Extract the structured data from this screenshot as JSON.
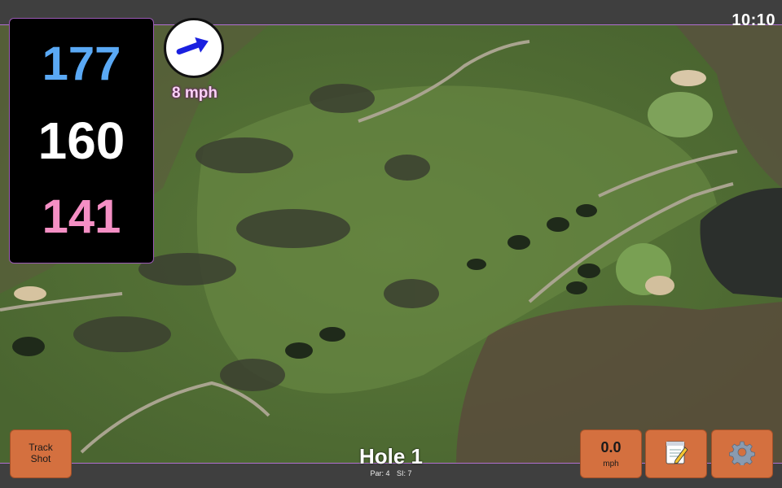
{
  "status": {
    "time": "10:10"
  },
  "yardage": {
    "back": "177",
    "center": "160",
    "front": "141"
  },
  "wind": {
    "speed": "8 mph",
    "icon": "wind-arrow-icon",
    "arrow_color": "#1a20e0"
  },
  "hole": {
    "title": "Hole 1",
    "par": "Par: 4",
    "si": "SI: 7"
  },
  "buttons": {
    "track_shot_line1": "Track",
    "track_shot_line2": "Shot",
    "speed_value": "0.0",
    "speed_unit": "mph",
    "notes_icon": "notepad-icon",
    "settings_icon": "gear-icon"
  },
  "colors": {
    "back_distance": "#5aa9f5",
    "center_distance": "#ffffff",
    "front_distance": "#f48fc4",
    "button": "#d4703f",
    "panel_border": "#9b59b6"
  }
}
